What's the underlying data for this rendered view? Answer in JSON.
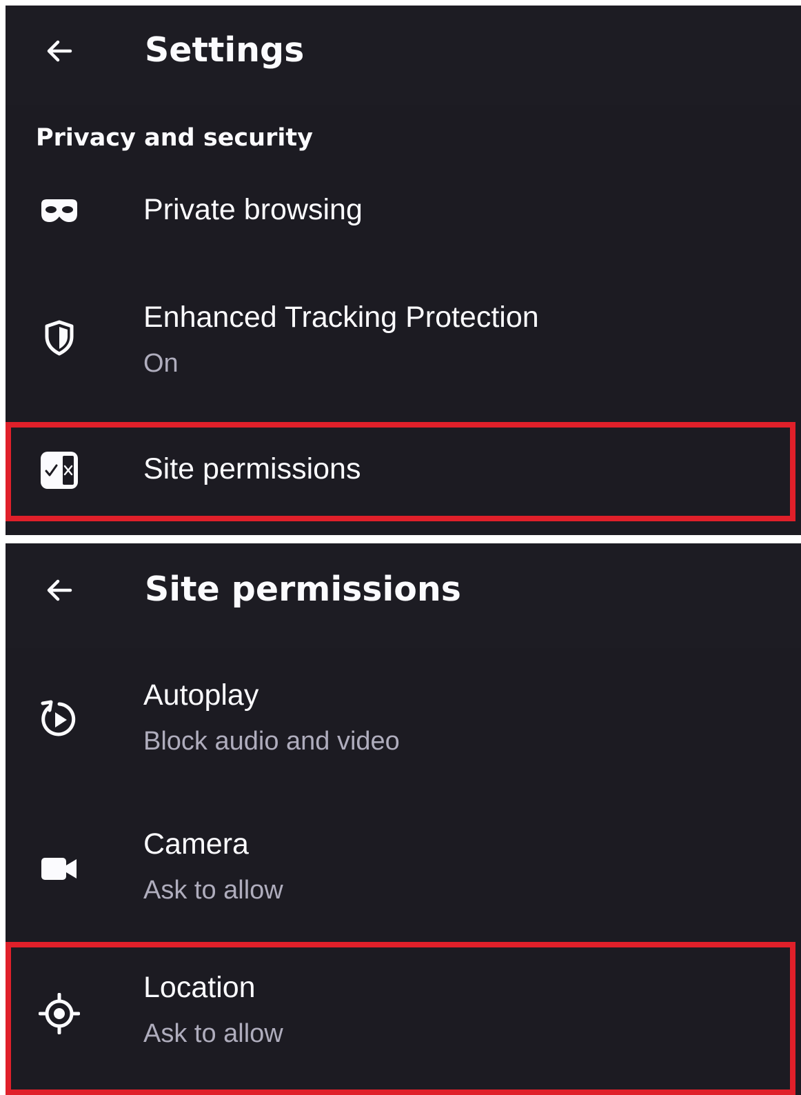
{
  "screen1": {
    "title": "Settings",
    "back_label": "back",
    "section_header": "Privacy and security",
    "items": [
      {
        "label": "Private browsing",
        "icon": "private-browsing-mask-icon"
      },
      {
        "label": "Enhanced Tracking Protection",
        "sublabel": "On",
        "icon": "shield-icon"
      },
      {
        "label": "Site permissions",
        "icon": "site-permissions-icon",
        "highlighted": true
      }
    ]
  },
  "screen2": {
    "title": "Site permissions",
    "items": [
      {
        "label": "Autoplay",
        "sublabel": "Block audio and video",
        "icon": "autoplay-icon"
      },
      {
        "label": "Camera",
        "sublabel": "Ask to allow",
        "icon": "camera-icon"
      },
      {
        "label": "Location",
        "sublabel": "Ask to allow",
        "icon": "location-icon",
        "highlighted": true
      }
    ]
  },
  "colors": {
    "background": "#1c1b22",
    "text_primary": "#fbfbfe",
    "text_secondary": "#afadbd",
    "highlight": "#e0202a"
  }
}
